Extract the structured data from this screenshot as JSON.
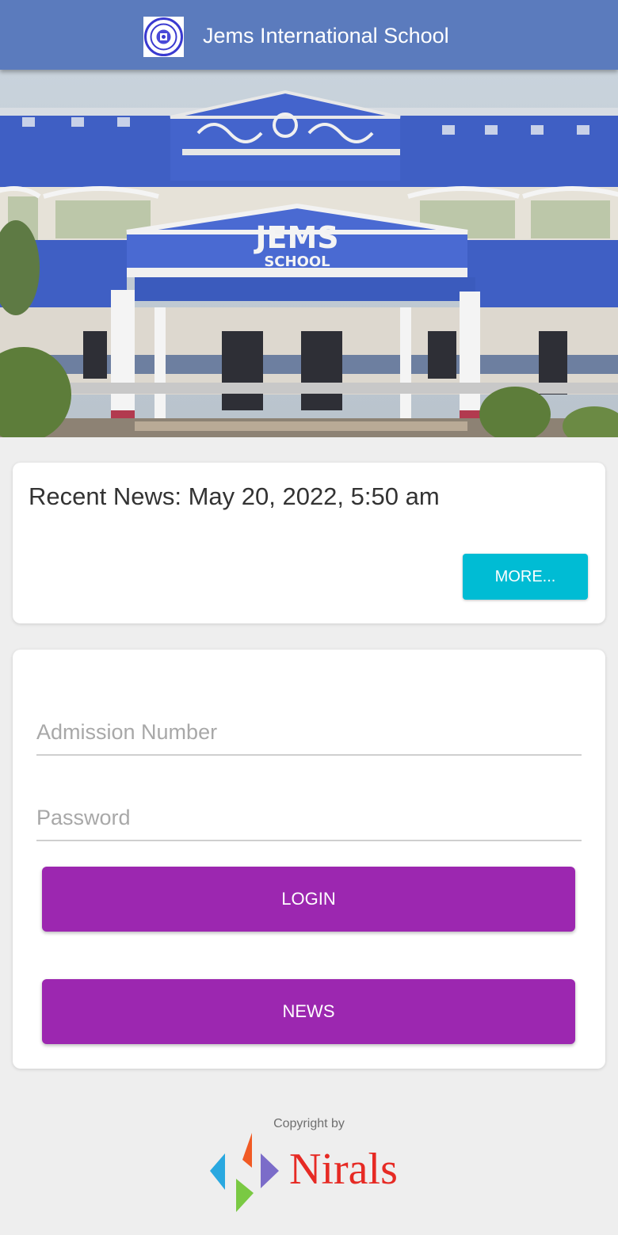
{
  "header": {
    "title": "Jems International School",
    "brand_color": "#5b7bbd"
  },
  "hero": {
    "sign_main": "JEMS",
    "sign_sub": "SCHOOL"
  },
  "news_card": {
    "text": "Recent News: May 20, 2022, 5:50 am",
    "more_label": "MORE..."
  },
  "login_form": {
    "admission_placeholder": "Admission Number",
    "admission_value": "",
    "password_placeholder": "Password",
    "password_value": "",
    "login_label": "LOGIN",
    "news_label": "NEWS",
    "button_color": "#9c27b0"
  },
  "footer": {
    "copyright": "Copyright by",
    "brand": "Nirals"
  },
  "colors": {
    "accent_cyan": "#00bcd4",
    "background": "#eeeeee"
  }
}
